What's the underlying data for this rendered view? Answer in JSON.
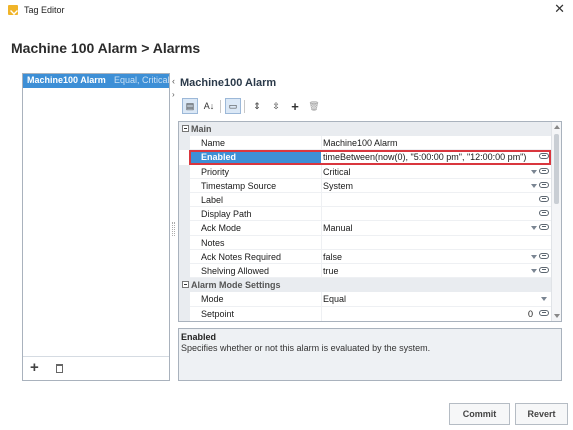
{
  "window": {
    "title": "Tag Editor",
    "icon": "tag-editor-icon",
    "close_glyph": "✕"
  },
  "heading": "Machine 100 Alarm > Alarms",
  "alarm_list": {
    "items": [
      {
        "name": "Machine100 Alarm",
        "mode": "Equal, Critical"
      }
    ],
    "add_glyph": "+",
    "delete_icon": "trash-icon"
  },
  "editor": {
    "title": "Machine100 Alarm",
    "collapse_glyph": "‹",
    "expand_glyph": "›"
  },
  "toolbar": {
    "buttons": [
      {
        "icon": "categorized-view-icon",
        "glyph": "▤",
        "active": true
      },
      {
        "icon": "sort-alpha-icon",
        "glyph": "A↓",
        "active": false
      },
      {
        "icon": "display-mode-icon",
        "glyph": "▭",
        "active": true
      },
      {
        "icon": "expand-all-icon",
        "glyph": "⇕",
        "active": false
      },
      {
        "icon": "collapse-all-icon",
        "glyph": "⇳",
        "active": false
      },
      {
        "icon": "add-property-icon",
        "glyph": "+",
        "active": false
      },
      {
        "icon": "delete-property-icon",
        "glyph": "🗑",
        "active": false
      }
    ]
  },
  "properties": {
    "sections": [
      {
        "label": "Main",
        "rows": [
          {
            "name": "Name",
            "value": "Machine100 Alarm",
            "dropdown": false,
            "link": false
          },
          {
            "name": "Enabled",
            "value": "timeBetween(now(0), \"5:00:00 pm\", \"12:00:00 pm\")",
            "dropdown": false,
            "link": true,
            "selected": true
          },
          {
            "name": "Priority",
            "value": "Critical",
            "dropdown": true,
            "link": true
          },
          {
            "name": "Timestamp Source",
            "value": "System",
            "dropdown": true,
            "link": true
          },
          {
            "name": "Label",
            "value": "",
            "dropdown": false,
            "link": true
          },
          {
            "name": "Display Path",
            "value": "",
            "dropdown": false,
            "link": true
          },
          {
            "name": "Ack Mode",
            "value": "Manual",
            "dropdown": true,
            "link": true
          },
          {
            "name": "Notes",
            "value": "",
            "dropdown": false,
            "link": false
          },
          {
            "name": "Ack Notes Required",
            "value": "false",
            "dropdown": true,
            "link": true
          },
          {
            "name": "Shelving Allowed",
            "value": "true",
            "dropdown": true,
            "link": true
          }
        ]
      },
      {
        "label": "Alarm Mode Settings",
        "rows": [
          {
            "name": "Mode",
            "value": "Equal",
            "dropdown": true,
            "link": false
          },
          {
            "name": "Setpoint",
            "value": "0",
            "dropdown": false,
            "link": true
          }
        ]
      }
    ]
  },
  "description": {
    "title": "Enabled",
    "text": "Specifies whether or not this alarm is evaluated by the system."
  },
  "footer": {
    "commit_label": "Commit",
    "revert_label": "Revert"
  },
  "colors": {
    "selection": "#3d8fd6",
    "highlight_border": "#d9363e",
    "section_bg": "#e9ecf0"
  }
}
